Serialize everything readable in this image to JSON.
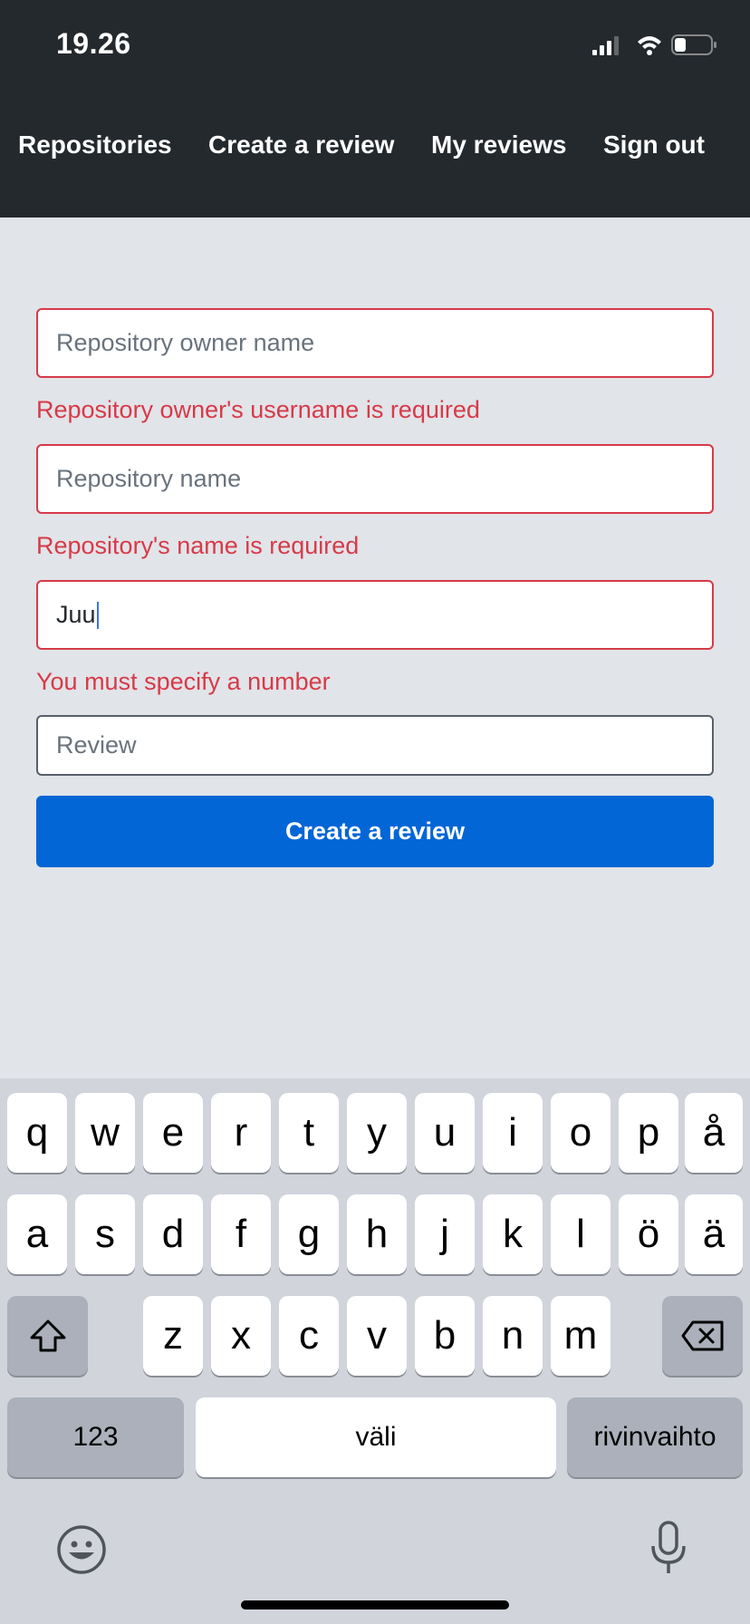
{
  "status_bar": {
    "time": "19.26"
  },
  "nav": {
    "items": [
      {
        "label": "Repositories"
      },
      {
        "label": "Create a review"
      },
      {
        "label": "My reviews"
      },
      {
        "label": "Sign out"
      }
    ]
  },
  "form": {
    "owner": {
      "placeholder": "Repository owner name",
      "error": "Repository owner's username is required"
    },
    "repo": {
      "placeholder": "Repository name",
      "error": "Repository's name is required"
    },
    "rating": {
      "value": "Juu",
      "error": "You must specify a number"
    },
    "review": {
      "placeholder": "Review"
    },
    "submit_label": "Create a review"
  },
  "keyboard": {
    "row1": [
      "q",
      "w",
      "e",
      "r",
      "t",
      "y",
      "u",
      "i",
      "o",
      "p",
      "å"
    ],
    "row2": [
      "a",
      "s",
      "d",
      "f",
      "g",
      "h",
      "j",
      "k",
      "l",
      "ö",
      "ä"
    ],
    "row3": [
      "z",
      "x",
      "c",
      "v",
      "b",
      "n",
      "m"
    ],
    "numbers_label": "123",
    "space_label": "väli",
    "return_label": "rivinvaihto",
    "icons": {
      "shift": "shift-icon",
      "backspace": "backspace-icon",
      "emoji": "emoji-icon",
      "mic": "microphone-icon"
    }
  }
}
